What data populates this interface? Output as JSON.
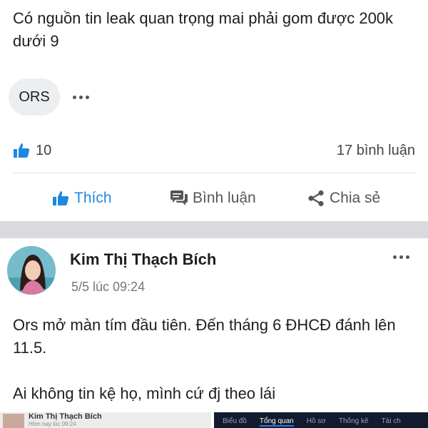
{
  "post1": {
    "text": "Có nguồn tin leak quan trọng mai phải gom được 200k dưới 9",
    "tag": "ORS",
    "likes": "10",
    "comments": "17 bình luận"
  },
  "actions": {
    "like": "Thích",
    "comment": "Bình luận",
    "share": "Chia sẻ"
  },
  "post2": {
    "author": "Kim Thị Thạch Bích",
    "time": "5/5 lúc 09:24",
    "line1": "Ors mở màn tím đầu tiên. Đến tháng 6 ĐHCĐ đánh lên 11.5.",
    "line2": "Ai không tin kệ họ, mình cứ đj theo lái"
  },
  "thumbnails": {
    "left_name": "Kim Thị Thạch Bích",
    "left_sub": "Hôm nay lúc 09:24",
    "right_tabs": [
      "Biểu đồ",
      "Tổng quan",
      "Hồ sơ",
      "Thống kê",
      "Tài ch"
    ]
  },
  "colors": {
    "accent": "#1d87e4",
    "divider": "#dcdfe3",
    "section_gap": "#d9dadd"
  }
}
